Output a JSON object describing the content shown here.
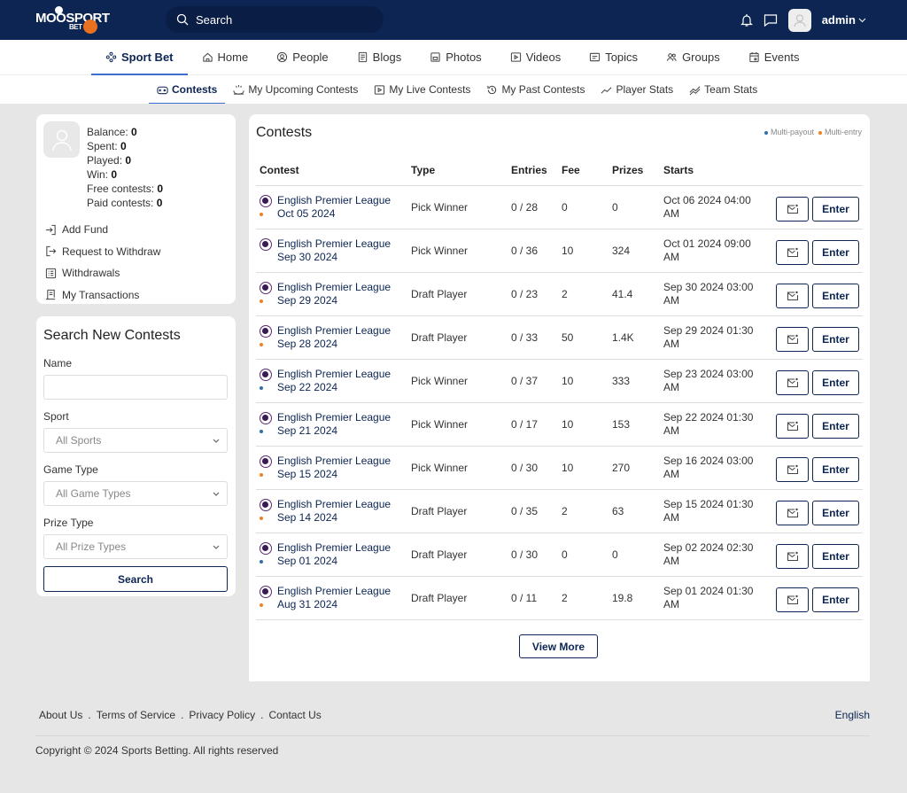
{
  "header": {
    "logo_text": "MOOSPORT",
    "logo_sub": "BET",
    "search_placeholder": "Search",
    "user_name": "admin"
  },
  "main_nav": [
    {
      "label": "Sport Bet",
      "icon": "sport-bet-icon",
      "active": true
    },
    {
      "label": "Home",
      "icon": "home-icon"
    },
    {
      "label": "People",
      "icon": "people-icon"
    },
    {
      "label": "Blogs",
      "icon": "blogs-icon"
    },
    {
      "label": "Photos",
      "icon": "photos-icon"
    },
    {
      "label": "Videos",
      "icon": "videos-icon"
    },
    {
      "label": "Topics",
      "icon": "topics-icon"
    },
    {
      "label": "Groups",
      "icon": "groups-icon"
    },
    {
      "label": "Events",
      "icon": "events-icon"
    }
  ],
  "sub_nav": [
    {
      "label": "Contests",
      "icon": "gamepad-icon",
      "active": true
    },
    {
      "label": "My Upcoming Contests",
      "icon": "upcoming-icon"
    },
    {
      "label": "My Live Contests",
      "icon": "live-icon"
    },
    {
      "label": "My Past Contests",
      "icon": "history-icon"
    },
    {
      "label": "Player Stats",
      "icon": "line-chart-icon"
    },
    {
      "label": "Team Stats",
      "icon": "multi-line-chart-icon"
    }
  ],
  "profile": {
    "stats": [
      {
        "label": "Balance:",
        "value": "0"
      },
      {
        "label": "Spent:",
        "value": "0"
      },
      {
        "label": "Played:",
        "value": "0"
      },
      {
        "label": "Win:",
        "value": "0"
      },
      {
        "label": "Free contests:",
        "value": "0"
      },
      {
        "label": "Paid contests:",
        "value": "0"
      }
    ],
    "links": [
      {
        "label": "Add Fund",
        "icon": "login-icon"
      },
      {
        "label": "Request to Withdraw",
        "icon": "logout-icon"
      },
      {
        "label": "Withdrawals",
        "icon": "list-icon"
      },
      {
        "label": "My Transactions",
        "icon": "receipt-icon"
      }
    ]
  },
  "search_panel": {
    "title": "Search New Contests",
    "name_label": "Name",
    "name_value": "",
    "sport_label": "Sport",
    "sport_value": "All Sports",
    "game_type_label": "Game Type",
    "game_type_value": "All Game Types",
    "prize_type_label": "Prize Type",
    "prize_type_value": "All Prize Types",
    "search_button": "Search"
  },
  "contests": {
    "title": "Contests",
    "legend": [
      {
        "label": "Multi-payout",
        "color": "#2f6fa6"
      },
      {
        "label": "Multi-entry",
        "color": "#f08020"
      }
    ],
    "columns": [
      "Contest",
      "Type",
      "Entries",
      "Fee",
      "Prizes",
      "Starts"
    ],
    "enter_label": "Enter",
    "view_more": "View More",
    "rows": [
      {
        "league": "English Premier League",
        "date": "Oct 05 2024",
        "dot": "#f08020",
        "type": "Pick Winner",
        "entries": "0 / 28",
        "fee": "0",
        "prizes": "0",
        "starts1": "Oct 06 2024 04:00",
        "starts2": "AM"
      },
      {
        "league": "English Premier League",
        "date": "Sep 30 2024",
        "dot": "",
        "type": "Pick Winner",
        "entries": "0 / 36",
        "fee": "10",
        "prizes": "324",
        "starts1": "Oct 01 2024 09:00",
        "starts2": "AM"
      },
      {
        "league": "English Premier League",
        "date": "Sep 29 2024",
        "dot": "#f08020",
        "type": "Draft Player",
        "entries": "0 / 23",
        "fee": "2",
        "prizes": "41.4",
        "starts1": "Sep 30 2024 03:00",
        "starts2": "AM"
      },
      {
        "league": "English Premier League",
        "date": "Sep 28 2024",
        "dot": "#f08020",
        "type": "Draft Player",
        "entries": "0 / 33",
        "fee": "50",
        "prizes": "1.4K",
        "starts1": "Sep 29 2024 01:30",
        "starts2": "AM"
      },
      {
        "league": "English Premier League",
        "date": "Sep 22 2024",
        "dot": "#2f6fa6",
        "type": "Pick Winner",
        "entries": "0 / 37",
        "fee": "10",
        "prizes": "333",
        "starts1": "Sep 23 2024 03:00",
        "starts2": "AM"
      },
      {
        "league": "English Premier League",
        "date": "Sep 21 2024",
        "dot": "#2f6fa6",
        "type": "Pick Winner",
        "entries": "0 / 17",
        "fee": "10",
        "prizes": "153",
        "starts1": "Sep 22 2024 01:30",
        "starts2": "AM"
      },
      {
        "league": "English Premier League",
        "date": "Sep 15 2024",
        "dot": "#f08020",
        "type": "Pick Winner",
        "entries": "0 / 30",
        "fee": "10",
        "prizes": "270",
        "starts1": "Sep 16 2024 03:00",
        "starts2": "AM"
      },
      {
        "league": "English Premier League",
        "date": "Sep 14 2024",
        "dot": "#f08020",
        "type": "Draft Player",
        "entries": "0 / 35",
        "fee": "2",
        "prizes": "63",
        "starts1": "Sep 15 2024 01:30",
        "starts2": "AM"
      },
      {
        "league": "English Premier League",
        "date": "Sep 01 2024",
        "dot": "#2f6fa6",
        "type": "Draft Player",
        "entries": "0 / 30",
        "fee": "0",
        "prizes": "0",
        "starts1": "Sep 02 2024 02:30",
        "starts2": "AM"
      },
      {
        "league": "English Premier League",
        "date": "Aug 31 2024",
        "dot": "#f08020",
        "type": "Draft Player",
        "entries": "0 / 11",
        "fee": "2",
        "prizes": "19.8",
        "starts1": "Sep 01 2024 01:30",
        "starts2": "AM"
      }
    ]
  },
  "footer": {
    "links": [
      "About Us",
      "Terms of Service",
      "Privacy Policy",
      "Contact Us"
    ],
    "separator": ".",
    "language": "English",
    "copyright": "Copyright © 2024 Sports Betting. All rights reserved"
  }
}
